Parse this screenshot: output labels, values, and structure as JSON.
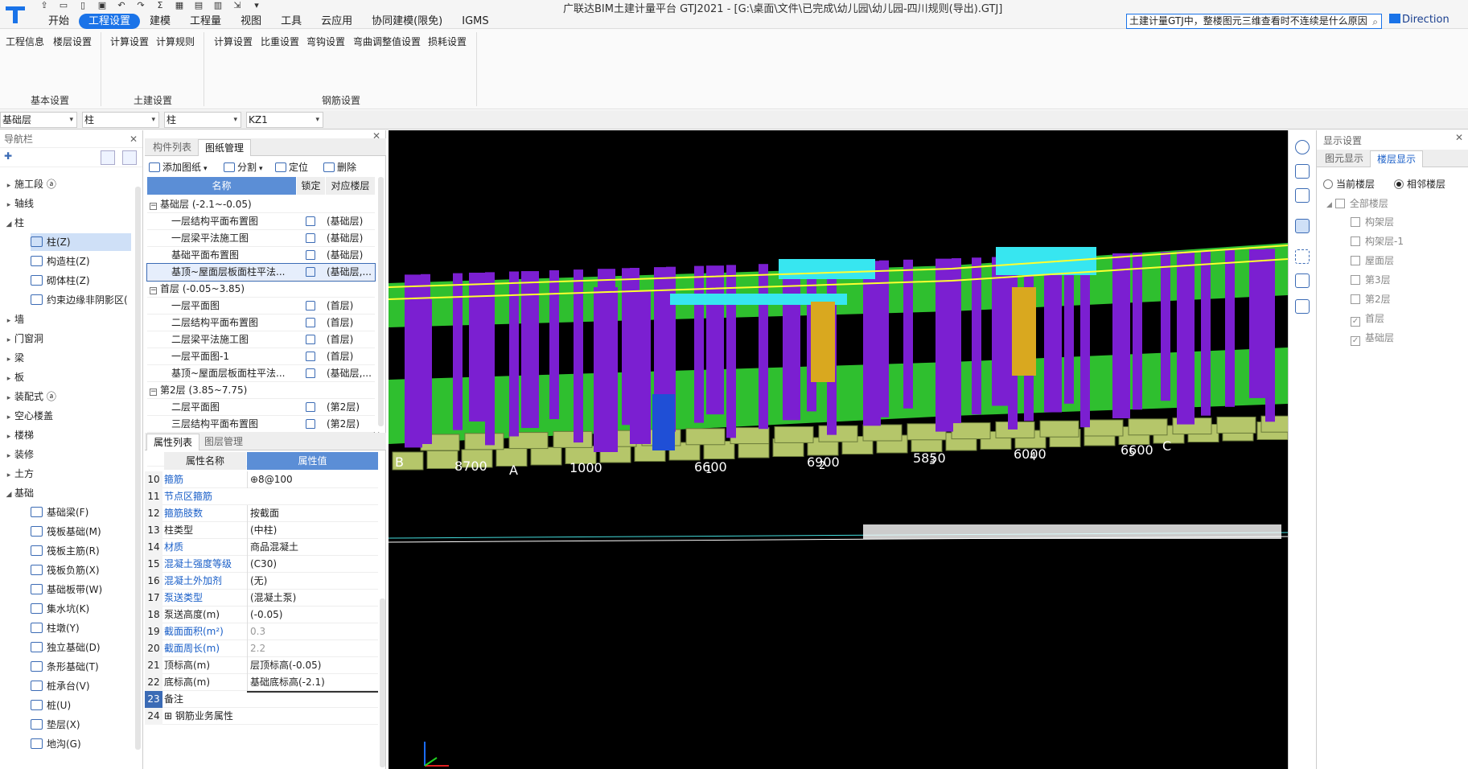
{
  "window": {
    "title": "广联达BIM土建计量平台 GTJ2021 - [G:\\桌面\\文件\\已完成\\幼儿园\\幼儿园-四川规则(导出).GTJ]"
  },
  "menu": [
    "开始",
    "工程设置",
    "建模",
    "工程量",
    "视图",
    "工具",
    "云应用",
    "协同建模(限免)",
    "IGMS"
  ],
  "menu_active": "工程设置",
  "search": {
    "value": "土建计量GTJ中，整楼图元三维查看时不连续是什么原因"
  },
  "direction_label": "Direction",
  "ribbon": {
    "buttons": [
      "工程信息",
      "楼层设置",
      "计算设置",
      "计算规则",
      "计算设置",
      "比重设置",
      "弯钩设置",
      "弯曲调整值设置",
      "损耗设置"
    ],
    "groups": [
      "基本设置",
      "土建设置",
      "钢筋设置"
    ]
  },
  "selectors": [
    "基础层",
    "柱",
    "柱",
    "KZ1"
  ],
  "nav": {
    "title": "导航栏",
    "items": [
      {
        "label": "施工段 ⓐ",
        "type": "group",
        "expanded": false
      },
      {
        "label": "轴线",
        "type": "group",
        "expanded": false
      },
      {
        "label": "柱",
        "type": "group",
        "expanded": true
      },
      {
        "label": "柱(Z)",
        "type": "child",
        "selected": true
      },
      {
        "label": "构造柱(Z)",
        "type": "child"
      },
      {
        "label": "砌体柱(Z)",
        "type": "child"
      },
      {
        "label": "约束边缘非阴影区(",
        "type": "child"
      },
      {
        "label": "墙",
        "type": "group"
      },
      {
        "label": "门窗洞",
        "type": "group"
      },
      {
        "label": "梁",
        "type": "group"
      },
      {
        "label": "板",
        "type": "group"
      },
      {
        "label": "装配式 ⓐ",
        "type": "group"
      },
      {
        "label": "空心楼盖",
        "type": "group"
      },
      {
        "label": "楼梯",
        "type": "group"
      },
      {
        "label": "装修",
        "type": "group"
      },
      {
        "label": "土方",
        "type": "group"
      },
      {
        "label": "基础",
        "type": "group",
        "expanded": true
      },
      {
        "label": "基础梁(F)",
        "type": "child"
      },
      {
        "label": "筏板基础(M)",
        "type": "child"
      },
      {
        "label": "筏板主筋(R)",
        "type": "child"
      },
      {
        "label": "筏板负筋(X)",
        "type": "child"
      },
      {
        "label": "基础板带(W)",
        "type": "child"
      },
      {
        "label": "集水坑(K)",
        "type": "child"
      },
      {
        "label": "柱墩(Y)",
        "type": "child"
      },
      {
        "label": "独立基础(D)",
        "type": "child"
      },
      {
        "label": "条形基础(T)",
        "type": "child"
      },
      {
        "label": "桩承台(V)",
        "type": "child"
      },
      {
        "label": "桩(U)",
        "type": "child"
      },
      {
        "label": "垫层(X)",
        "type": "child"
      },
      {
        "label": "地沟(G)",
        "type": "child"
      }
    ]
  },
  "drawing_panel": {
    "tabs": [
      "构件列表",
      "图纸管理"
    ],
    "tools": [
      "添加图纸",
      "分割",
      "定位",
      "删除"
    ],
    "columns": [
      "名称",
      "锁定",
      "对应楼层"
    ],
    "rows": [
      {
        "name": "基础层 (-2.1~-0.05)",
        "group": true
      },
      {
        "name": "一层结构平面布置图",
        "floor": "(基础层)"
      },
      {
        "name": "一层梁平法施工图",
        "floor": "(基础层)"
      },
      {
        "name": "基础平面布置图",
        "floor": "(基础层)"
      },
      {
        "name": "基顶~屋面层板面柱平法...",
        "floor": "(基础层,...",
        "selected": true
      },
      {
        "name": "首层 (-0.05~3.85)",
        "group": true
      },
      {
        "name": "一层平面图",
        "floor": "(首层)"
      },
      {
        "name": "二层结构平面布置图",
        "floor": "(首层)"
      },
      {
        "name": "二层梁平法施工图",
        "floor": "(首层)"
      },
      {
        "name": "一层平面图-1",
        "floor": "(首层)"
      },
      {
        "name": "基顶~屋面层板面柱平法...",
        "floor": "(基础层,..."
      },
      {
        "name": "第2层 (3.85~7.75)",
        "group": true
      },
      {
        "name": "二层平面图",
        "floor": "(第2层)"
      },
      {
        "name": "三层结构平面布置图",
        "floor": "(第2层)"
      },
      {
        "name": "三层梁平法施工图",
        "floor": "(第2层)"
      },
      {
        "name": "二层平面图-1",
        "floor": "(第2层)"
      }
    ]
  },
  "property_panel": {
    "tabs": [
      "属性列表",
      "图层管理"
    ],
    "columns": [
      "属性名称",
      "属性值"
    ],
    "rows": [
      {
        "n": "10",
        "k": "箍筋",
        "v": "⊕8@100",
        "blue": true
      },
      {
        "n": "11",
        "k": "节点区箍筋",
        "v": "",
        "blue": true
      },
      {
        "n": "12",
        "k": "箍筋肢数",
        "v": "按截面",
        "blue": true
      },
      {
        "n": "13",
        "k": "柱类型",
        "v": "(中柱)"
      },
      {
        "n": "14",
        "k": "材质",
        "v": "商品混凝土",
        "blue": true
      },
      {
        "n": "15",
        "k": "混凝土强度等级",
        "v": "(C30)",
        "blue": true
      },
      {
        "n": "16",
        "k": "混凝土外加剂",
        "v": "(无)",
        "blue": true
      },
      {
        "n": "17",
        "k": "泵送类型",
        "v": "(混凝土泵)",
        "blue": true
      },
      {
        "n": "18",
        "k": "泵送高度(m)",
        "v": "(-0.05)"
      },
      {
        "n": "19",
        "k": "截面面积(m²)",
        "v": "0.3",
        "blue": true,
        "grey": true
      },
      {
        "n": "20",
        "k": "截面周长(m)",
        "v": "2.2",
        "blue": true,
        "grey": true
      },
      {
        "n": "21",
        "k": "顶标高(m)",
        "v": "层顶标高(-0.05)"
      },
      {
        "n": "22",
        "k": "底标高(m)",
        "v": "基础底标高(-2.1)"
      },
      {
        "n": "23",
        "k": "备注",
        "v": "",
        "selected": true
      },
      {
        "n": "24",
        "k": "⊞ 钢筋业务属性",
        "v": ""
      }
    ]
  },
  "display_panel": {
    "title": "显示设置",
    "tabs": [
      "图元显示",
      "楼层显示"
    ],
    "radios": [
      "当前楼层",
      "相邻楼层"
    ],
    "radio_selected": 1,
    "all_floors": "全部楼层",
    "floors": [
      {
        "label": "构架层",
        "checked": false
      },
      {
        "label": "构架层-1",
        "checked": false
      },
      {
        "label": "屋面层",
        "checked": false
      },
      {
        "label": "第3层",
        "checked": false
      },
      {
        "label": "第2层",
        "checked": false
      },
      {
        "label": "首层",
        "checked": true
      },
      {
        "label": "基础层",
        "checked": true
      }
    ]
  },
  "viewport": {
    "axis_labels": [
      "B",
      "8700",
      "A",
      "1000",
      "6600",
      "6900",
      "5850",
      "6000",
      "6600",
      "C",
      "1",
      "2",
      "3",
      "4",
      "5"
    ],
    "colors": {
      "column": "#7b1fd1",
      "beam": "#2fbf2f",
      "foundation": "#b5c66a",
      "highlight": "#37e6f0",
      "gold": "#d9a81f",
      "blue_col": "#1f4fd6",
      "background": "#000000"
    }
  }
}
